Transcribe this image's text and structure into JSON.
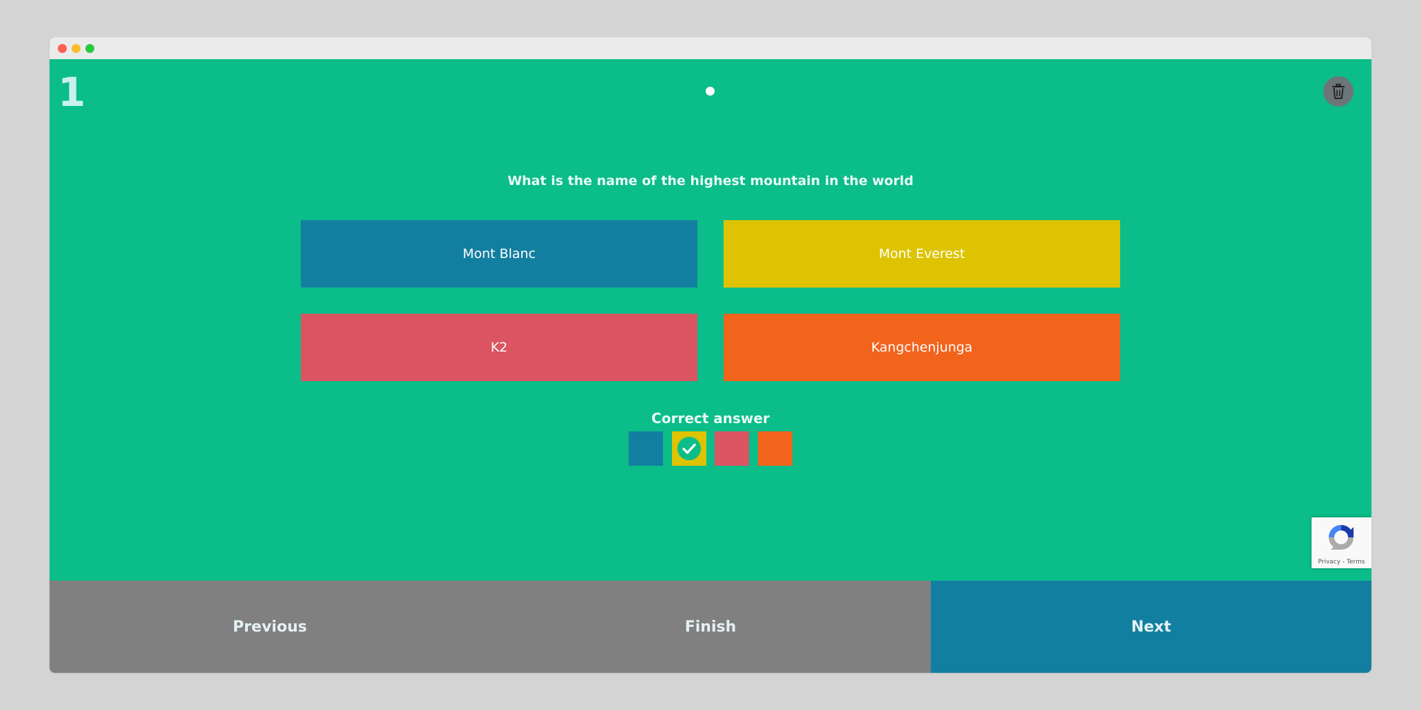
{
  "window": {
    "controls": [
      "close",
      "minimize",
      "maximize"
    ]
  },
  "quiz": {
    "question_number": "1",
    "question": "What is the name of the highest mountain in the world",
    "answers": [
      {
        "label": "Mont Blanc",
        "color": "#137fa0"
      },
      {
        "label": "Mont Everest",
        "color": "#ddc301"
      },
      {
        "label": "K2",
        "color": "#db5462"
      },
      {
        "label": "Kangchenjunga",
        "color": "#f2631c"
      }
    ],
    "correct_answer_label": "Correct answer",
    "correct_answer_index": 1,
    "background_color": "#0bbd88",
    "progress_dots": 1
  },
  "icons": {
    "delete": "trash-icon",
    "correct": "check-icon"
  },
  "recaptcha": {
    "links": "Privacy - Terms"
  },
  "footer": {
    "previous_label": "Previous",
    "finish_label": "Finish",
    "next_label": "Next",
    "next_color": "#137fa0",
    "neutral_color": "#808080"
  }
}
